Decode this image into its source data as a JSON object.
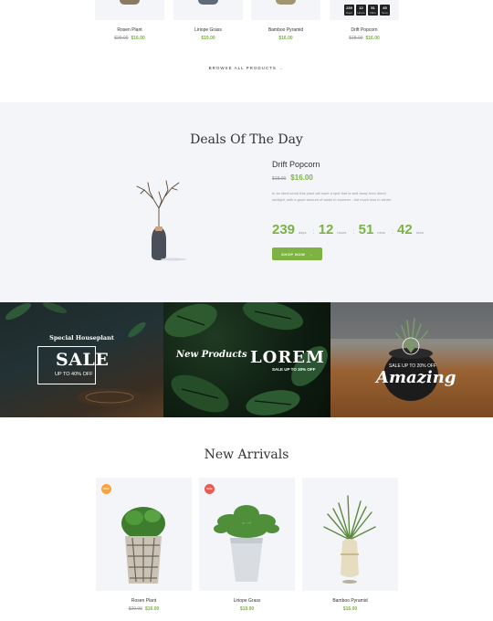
{
  "top_products": [
    {
      "name": "Rosen Plant",
      "old_price": "$20.00",
      "price": "$16.00"
    },
    {
      "name": "Liriope Grass",
      "old_price": "",
      "price": "$19.00"
    },
    {
      "name": "Bamboo Pyramid",
      "old_price": "",
      "price": "$16.00"
    },
    {
      "name": "Drift Popcorn",
      "old_price": "$18.00",
      "price": "$16.00",
      "countdown": [
        {
          "value": "239",
          "unit": "Days"
        },
        {
          "value": "12",
          "unit": "Hours"
        },
        {
          "value": "51",
          "unit": "Mins"
        },
        {
          "value": "45",
          "unit": "Secs"
        }
      ]
    }
  ],
  "browse_label": "BROWSE ALL PRODUCTS",
  "deals": {
    "title": "Deals Of The Day",
    "product_name": "Drift Popcorn",
    "old_price": "$18.00",
    "price": "$16.00",
    "description": "In an ideal world this plant will want a spot that is well away from direct sunlight, with a good amount of water in summer - but much less in winter.",
    "countdown": [
      {
        "value": "239",
        "unit": "days"
      },
      {
        "value": "12",
        "unit": "hours"
      },
      {
        "value": "51",
        "unit": "mins"
      },
      {
        "value": "42",
        "unit": "secs"
      }
    ],
    "button_label": "SHOP NOW"
  },
  "banners": {
    "b1": {
      "subtitle": "Special Houseplant",
      "headline": "SALE",
      "note": "UP TO 40% OFF"
    },
    "b2": {
      "italic": "New Products",
      "headline": "LOREM",
      "note": "SALE UP TO 30% OFF"
    },
    "b3": {
      "note": "SALE UP TO 20% OFF",
      "script": "Amazing"
    }
  },
  "arrivals": {
    "title": "New Arrivals",
    "items": [
      {
        "name": "Rosen Plant",
        "old_price": "$20.00",
        "price": "$16.00",
        "badge": "New",
        "badge_color": "#f7a440"
      },
      {
        "name": "Liriope Grass",
        "old_price": "",
        "price": "$19.00",
        "badge": "Sale",
        "badge_color": "#ee5a4f"
      },
      {
        "name": "Bamboo Pyramid",
        "old_price": "",
        "price": "$16.00",
        "badge": "",
        "badge_color": ""
      }
    ]
  },
  "colors": {
    "accent": "#7cb342",
    "section_bg": "#f4f5f9"
  }
}
